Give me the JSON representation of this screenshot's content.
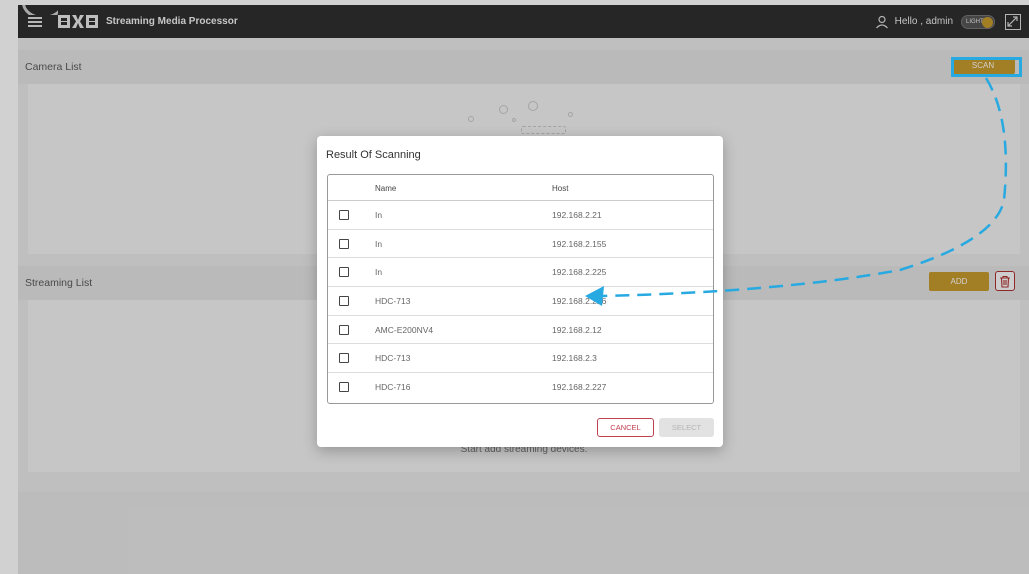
{
  "header": {
    "logo_text": "BXB",
    "title": "Streaming Media Processor",
    "greeting": "Hello , admin",
    "theme_toggle_label": "LIGHT"
  },
  "camera_section": {
    "title": "Camera List",
    "scan_label": "SCAN"
  },
  "streaming_section": {
    "title": "Streaming List",
    "add_label": "ADD",
    "empty_text": "Start add streaming devices."
  },
  "dialog": {
    "title": "Result Of Scanning",
    "columns": {
      "name": "Name",
      "host": "Host"
    },
    "rows": [
      {
        "name": "In",
        "host": "192.168.2.21"
      },
      {
        "name": "In",
        "host": "192.168.2.155"
      },
      {
        "name": "In",
        "host": "192.168.2.225"
      },
      {
        "name": "HDC-713",
        "host": "192.168.2.226"
      },
      {
        "name": "AMC-E200NV4",
        "host": "192.168.2.12"
      },
      {
        "name": "HDC-713",
        "host": "192.168.2.3"
      },
      {
        "name": "HDC-716",
        "host": "192.168.2.227"
      }
    ],
    "cancel_label": "CANCEL",
    "select_label": "SELECT"
  },
  "colors": {
    "accent_gold": "#c69a2e",
    "annotation_blue": "#27a9e1",
    "danger": "#c04050",
    "topbar": "#2f2f2f"
  }
}
